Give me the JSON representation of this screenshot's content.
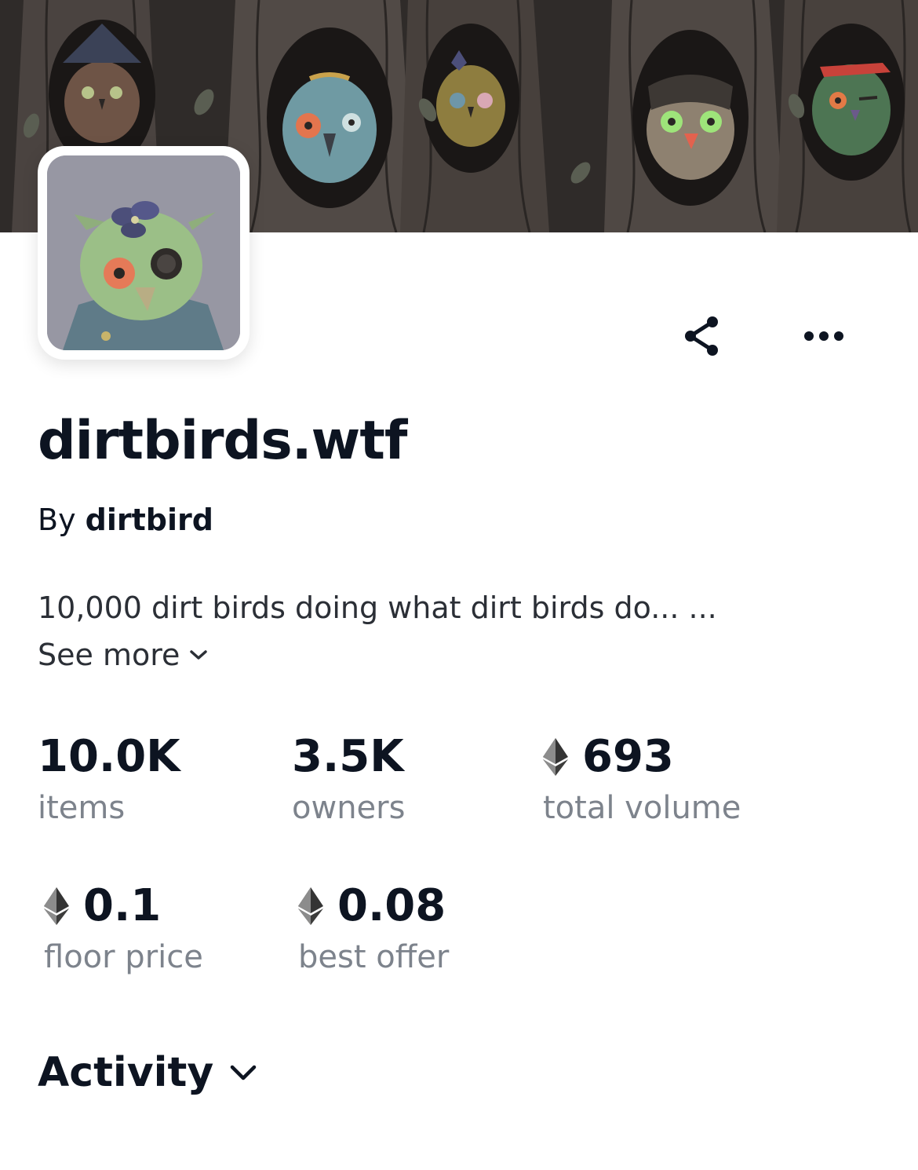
{
  "collection": {
    "name": "dirtbirds.wtf",
    "by_prefix": "By",
    "creator": "dirtbird",
    "description": "10,000 dirt birds doing what dirt birds do... ...",
    "see_more_label": "See more"
  },
  "stats": [
    {
      "value": "10.0K",
      "label": "items",
      "eth": false
    },
    {
      "value": "3.5K",
      "label": "owners",
      "eth": false
    },
    {
      "value": "693",
      "label": "total volume",
      "eth": true
    },
    {
      "value": "0.1",
      "label": "floor price",
      "eth": true
    },
    {
      "value": "0.08",
      "label": "best offer",
      "eth": true
    }
  ],
  "section": {
    "activity_label": "Activity"
  },
  "icons": {
    "share": "share-icon",
    "more": "more-options-icon",
    "eth": "ethereum-icon",
    "chevron": "chevron-down-icon"
  },
  "colors": {
    "text_primary": "#0d1421",
    "text_secondary": "#7d838c",
    "avatar_bg": "#9797a3"
  }
}
